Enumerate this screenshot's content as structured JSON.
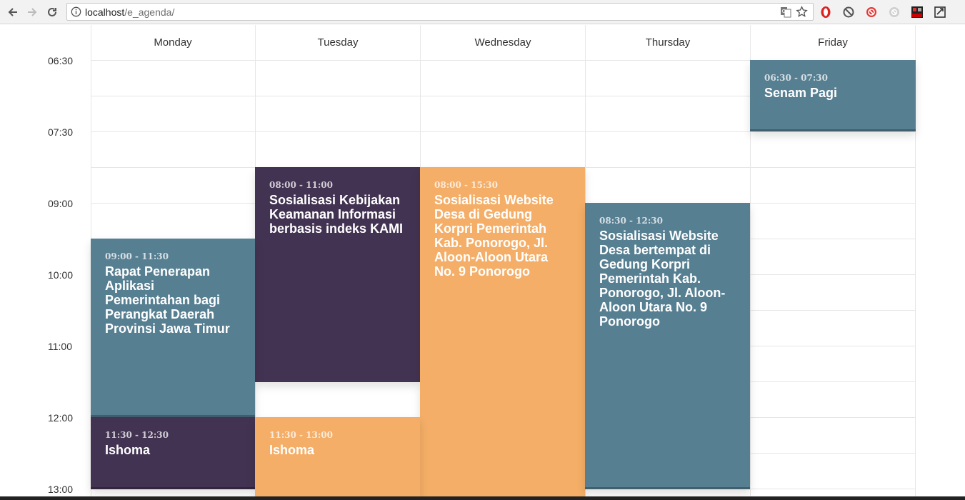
{
  "browser": {
    "url_host": "localhost",
    "url_path": "/e_agenda/",
    "icons": [
      "back-arrow-icon",
      "forward-arrow-icon",
      "reload-icon",
      "info-icon",
      "translate-icon",
      "star-icon",
      "opera-icon",
      "block-icon",
      "adblock-icon",
      "extension-gray-icon",
      "off-extension-icon",
      "screenshot-icon"
    ]
  },
  "calendar": {
    "days": [
      "Monday",
      "Tuesday",
      "Wednesday",
      "Thursday",
      "Friday"
    ],
    "times": [
      "06:30",
      "07:30",
      "09:00",
      "10:00",
      "11:00",
      "12:00",
      "13:00"
    ],
    "events": {
      "mon1": {
        "time": "09:00 - 11:30",
        "title": "Rapat Penerapan Aplikasi Pemerintahan bagi Perangkat Daerah Provinsi Jawa Timur"
      },
      "mon2": {
        "time": "11:30 - 12:30",
        "title": "Ishoma"
      },
      "tue1": {
        "time": "08:00 - 11:00",
        "title": "Sosialisasi Kebijakan Keamanan Informasi berbasis indeks KAMI"
      },
      "tue2": {
        "time": "11:30 - 13:00",
        "title": "Ishoma"
      },
      "wed1": {
        "time": "08:00 - 15:30",
        "title": "Sosialisasi Website Desa di Gedung Korpri Pemerintah Kab. Ponorogo, Jl. Aloon-Aloon Utara No. 9 Ponorogo"
      },
      "thu1": {
        "time": "08:30 - 12:30",
        "title": "Sosialisasi Website Desa bertempat di Gedung Korpri Pemerintah Kab. Ponorogo, Jl. Aloon-Aloon Utara No. 9 Ponorogo"
      },
      "fri1": {
        "time": "06:30 - 07:30",
        "title": "Senam Pagi"
      }
    },
    "colors": {
      "dark": "#433352",
      "blue": "#577f92",
      "orange": "#f4ae67"
    }
  }
}
